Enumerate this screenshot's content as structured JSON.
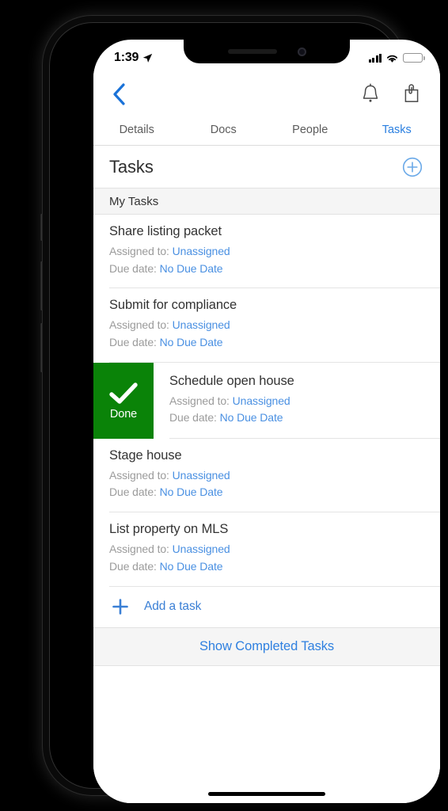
{
  "colors": {
    "accent_blue": "#4a90e2",
    "tab_active_blue": "#2a7fe0",
    "link_blue": "#3a7fd5",
    "done_green": "#0a8308",
    "section_bg": "#f5f5f5",
    "title_text": "#333333",
    "meta_text": "#9b9b9b"
  },
  "status_bar": {
    "time": "1:39",
    "location_icon": "location-arrow-icon",
    "signal_icon": "cellular-signal-icon",
    "wifi_icon": "wifi-icon",
    "battery_icon": "battery-icon"
  },
  "nav_bar": {
    "back_icon": "chevron-left-icon",
    "bell_icon": "notification-bell-icon",
    "attachment_icon": "attachment-document-icon"
  },
  "tabs": [
    {
      "label": "Details",
      "active": false
    },
    {
      "label": "Docs",
      "active": false
    },
    {
      "label": "People",
      "active": false
    },
    {
      "label": "Tasks",
      "active": true
    }
  ],
  "tasks_header": {
    "title": "Tasks",
    "add_icon": "plus-circle-icon"
  },
  "section": {
    "label": "My Tasks"
  },
  "labels": {
    "assigned_to": "Assigned to:",
    "due_date": "Due date:"
  },
  "tasks": [
    {
      "title": "Share listing packet",
      "assigned_to": "Unassigned",
      "due_date": "No Due Date",
      "swiped": false
    },
    {
      "title": "Submit for compliance",
      "assigned_to": "Unassigned",
      "due_date": "No Due Date",
      "swiped": false
    },
    {
      "title": "Schedule open house",
      "assigned_to": "Unassigned",
      "due_date": "No Due Date",
      "swiped": true,
      "swipe_action_label": "Done",
      "swipe_action_icon": "checkmark-icon"
    },
    {
      "title": "Stage house",
      "assigned_to": "Unassigned",
      "due_date": "No Due Date",
      "swiped": false
    },
    {
      "title": "List property on MLS",
      "assigned_to": "Unassigned",
      "due_date": "No Due Date",
      "swiped": false
    }
  ],
  "add_task": {
    "label": "Add a task",
    "icon": "plus-icon"
  },
  "show_completed": {
    "label": "Show Completed Tasks"
  }
}
